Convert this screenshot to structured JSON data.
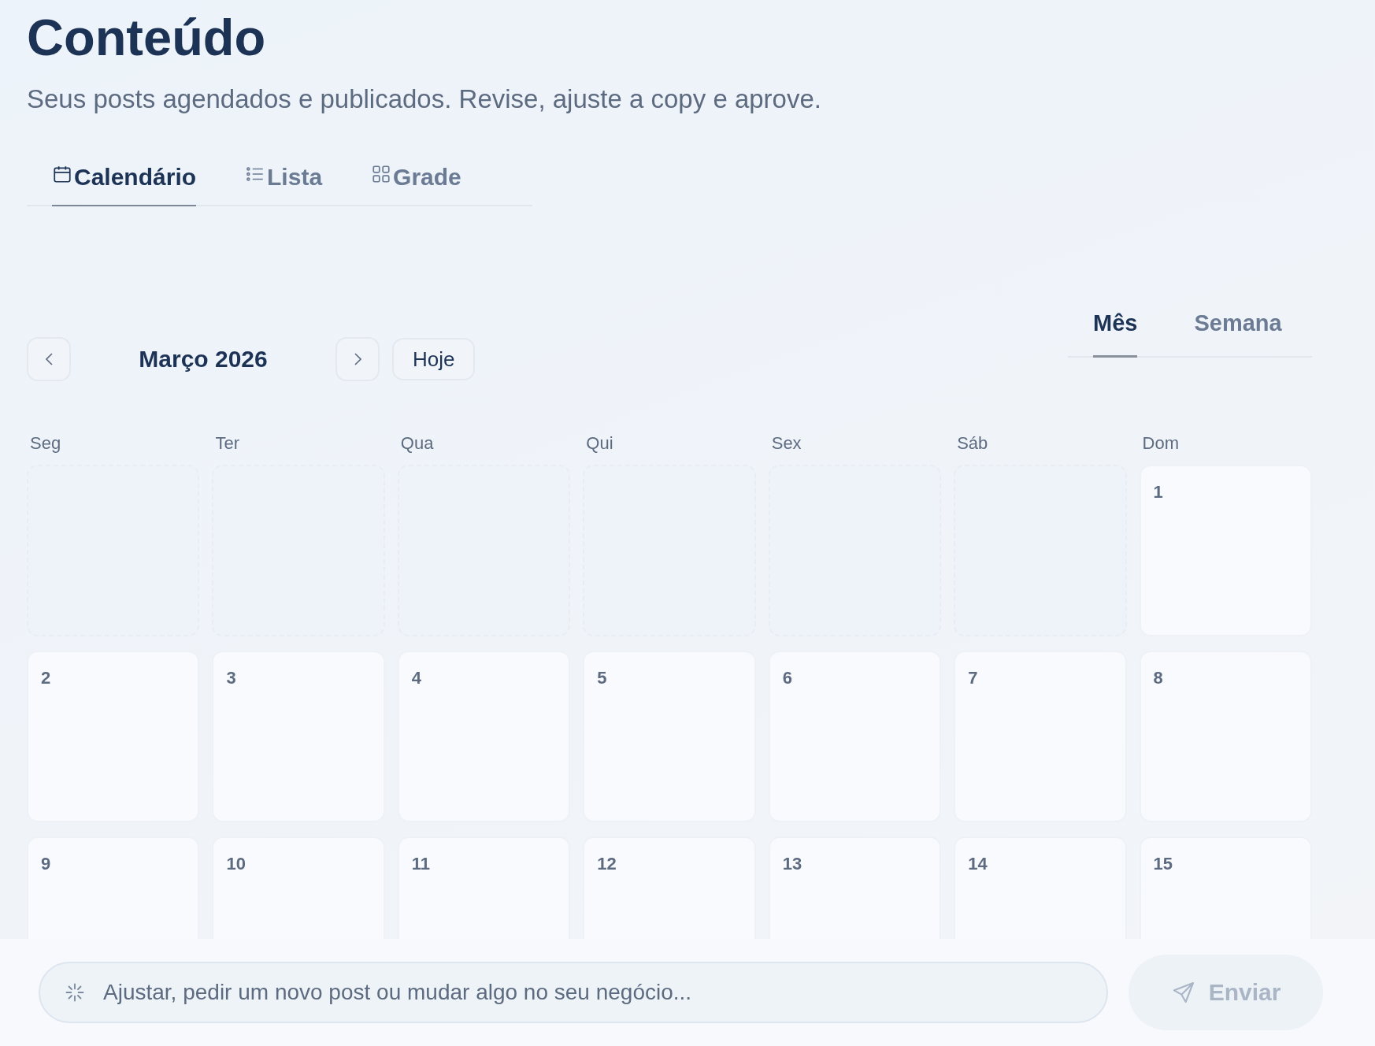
{
  "header": {
    "title": "Conteúdo",
    "subtitle": "Seus posts agendados e publicados. Revise, ajuste a copy e aprove."
  },
  "view_tabs": [
    {
      "label": "Calendário",
      "kind": "calendar",
      "selected": true
    },
    {
      "label": "Lista",
      "kind": "list",
      "selected": false
    },
    {
      "label": "Grade",
      "kind": "grid",
      "selected": false
    }
  ],
  "calendar": {
    "month": "Março 2026",
    "today_button": "Hoje",
    "range_tabs": [
      {
        "label": "Mês",
        "selected": true
      },
      {
        "label": "Semana",
        "selected": false
      }
    ],
    "weekdays": [
      "Seg",
      "Ter",
      "Qua",
      "Qui",
      "Sex",
      "Sáb",
      "Dom"
    ],
    "weeks": [
      [
        {
          "kind": "blank"
        },
        {
          "kind": "blank"
        },
        {
          "kind": "blank"
        },
        {
          "kind": "blank"
        },
        {
          "kind": "blank"
        },
        {
          "kind": "blank"
        },
        {
          "kind": "day",
          "label": "1"
        }
      ],
      [
        {
          "kind": "day",
          "label": "2"
        },
        {
          "kind": "day",
          "label": "3"
        },
        {
          "kind": "day",
          "label": "4"
        },
        {
          "kind": "day",
          "label": "5"
        },
        {
          "kind": "day",
          "label": "6"
        },
        {
          "kind": "day",
          "label": "7"
        },
        {
          "kind": "day",
          "label": "8"
        }
      ],
      [
        {
          "kind": "day",
          "label": "9"
        },
        {
          "kind": "day",
          "label": "10"
        },
        {
          "kind": "day",
          "label": "11"
        },
        {
          "kind": "day",
          "label": "12"
        },
        {
          "kind": "day",
          "label": "13"
        },
        {
          "kind": "day",
          "label": "14"
        },
        {
          "kind": "day",
          "label": "15"
        }
      ]
    ]
  },
  "composer": {
    "placeholder": "Ajustar, pedir um novo post ou mudar algo no seu negócio...",
    "send_button": {
      "label": "Enviar",
      "disabled": true
    }
  }
}
